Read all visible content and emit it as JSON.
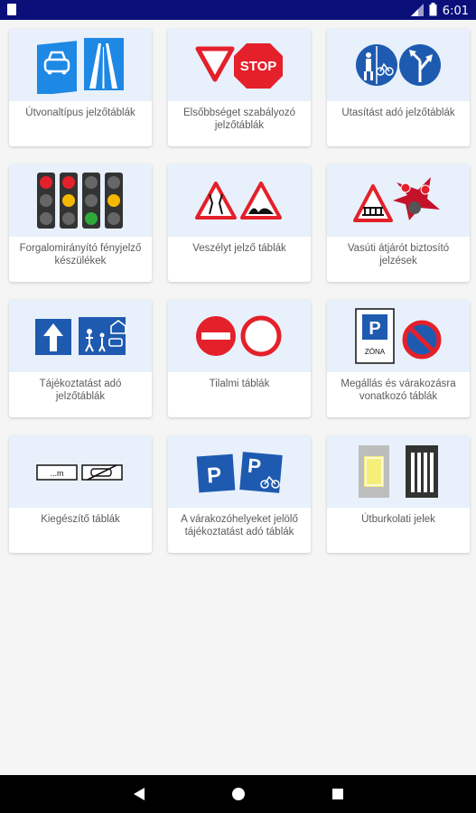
{
  "status_bar": {
    "time": "6:01",
    "left_icon": "sim-card-icon",
    "signal_icon": "signal-icon",
    "battery_icon": "battery-icon"
  },
  "categories": [
    {
      "label": "Útvonaltípus jelzőtáblák",
      "icon": "road-type-signs-icon"
    },
    {
      "label": "Elsőbbséget szabályozó jelzőtáblák",
      "icon": "priority-signs-icon"
    },
    {
      "label": "Utasítást adó jelzőtáblák",
      "icon": "mandatory-signs-icon"
    },
    {
      "label": "Forgalomirányító fényjelző készülékek",
      "icon": "traffic-lights-icon"
    },
    {
      "label": "Veszélyt jelző táblák",
      "icon": "warning-signs-icon"
    },
    {
      "label": "Vasúti átjárót biztosító jelzések",
      "icon": "railway-crossing-icon"
    },
    {
      "label": "Tájékoztatást adó jelzőtáblák",
      "icon": "information-signs-icon"
    },
    {
      "label": "Tilalmi táblák",
      "icon": "prohibition-signs-icon"
    },
    {
      "label": "Megállás és várakozásra vonatkozó táblák",
      "icon": "stopping-parking-signs-icon"
    },
    {
      "label": "Kiegészítő táblák",
      "icon": "supplementary-signs-icon"
    },
    {
      "label": "A várakozóhelyeket jelölő tájékoztatást adó táblák",
      "icon": "parking-place-signs-icon"
    },
    {
      "label": "Útburkolati jelek",
      "icon": "road-markings-icon"
    }
  ],
  "extra_text": {
    "stop_text": "STOP",
    "zone_text": "ZÓNA",
    "dist_text": "...m",
    "parking_letter": "P"
  },
  "colors": {
    "status_bar": "#0a0f7a",
    "sign_blue": "#1e5bb0",
    "sign_red": "#e4202a",
    "card_image_bg": "#e8f0fb"
  }
}
